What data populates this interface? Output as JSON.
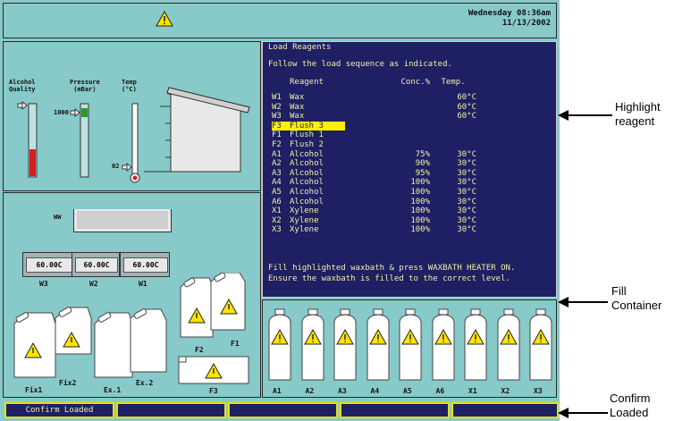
{
  "header": {
    "day_time": "Wednesday 08:36am",
    "date": "11/13/2002"
  },
  "gauges": {
    "alcohol_label": "Alcohol\nQuality",
    "pressure_label": "Pressure\n(mBar)",
    "temp_label": "Temp\n(°C)",
    "pressure_value": "1000",
    "temp_value": "02"
  },
  "waxbaths": {
    "ww_label": "WW",
    "baths": [
      {
        "temp": "60.00C",
        "label": "W3"
      },
      {
        "temp": "60.00C",
        "label": "W2"
      },
      {
        "temp": "60.00C",
        "label": "W1"
      }
    ]
  },
  "containers": {
    "left": [
      "Fix1",
      "Fix2",
      "Ex.1",
      "Ex.2"
    ],
    "flush": [
      "F2",
      "F1",
      "F3"
    ]
  },
  "reagent_panel": {
    "title": "Load Reagents",
    "instruction": "Follow the load sequence as indicated.",
    "headers": {
      "reagent": "Reagent",
      "conc": "Conc.%",
      "temp": "Temp."
    },
    "rows": [
      {
        "id": "W1",
        "name": "Wax",
        "conc": "",
        "temp": "60°C",
        "highlight": false
      },
      {
        "id": "W2",
        "name": "Wax",
        "conc": "",
        "temp": "60°C",
        "highlight": false
      },
      {
        "id": "W3",
        "name": "Wax",
        "conc": "",
        "temp": "60°C",
        "highlight": false
      },
      {
        "id": "F3",
        "name": "Flush 3",
        "conc": "",
        "temp": "",
        "highlight": true
      },
      {
        "id": "F1",
        "name": "Flush 1",
        "conc": "",
        "temp": "",
        "highlight": false
      },
      {
        "id": "F2",
        "name": "Flush 2",
        "conc": "",
        "temp": "",
        "highlight": false
      },
      {
        "id": "A1",
        "name": "Alcohol",
        "conc": "75%",
        "temp": "30°C",
        "highlight": false
      },
      {
        "id": "A2",
        "name": "Alcohol",
        "conc": "90%",
        "temp": "30°C",
        "highlight": false
      },
      {
        "id": "A3",
        "name": "Alcohol",
        "conc": "95%",
        "temp": "30°C",
        "highlight": false
      },
      {
        "id": "A4",
        "name": "Alcohol",
        "conc": "100%",
        "temp": "30°C",
        "highlight": false
      },
      {
        "id": "A5",
        "name": "Alcohol",
        "conc": "100%",
        "temp": "30°C",
        "highlight": false
      },
      {
        "id": "A6",
        "name": "Alcohol",
        "conc": "100%",
        "temp": "30°C",
        "highlight": false
      },
      {
        "id": "X1",
        "name": "Xylene",
        "conc": "100%",
        "temp": "30°C",
        "highlight": false
      },
      {
        "id": "X2",
        "name": "Xylene",
        "conc": "100%",
        "temp": "30°C",
        "highlight": false
      },
      {
        "id": "X3",
        "name": "Xylene",
        "conc": "100%",
        "temp": "30°C",
        "highlight": false
      }
    ],
    "message_line1": "Fill highlighted waxbath & press WAXBATH HEATER ON.",
    "message_line2": "Ensure the waxbath is filled to the correct level."
  },
  "reagent_bottles": [
    "A1",
    "A2",
    "A3",
    "A4",
    "A5",
    "A6",
    "X1",
    "X2",
    "X3"
  ],
  "footer": {
    "confirm_label": "Confirm Loaded",
    "btn2": "",
    "btn3": "",
    "btn4": "",
    "btn5": ""
  },
  "annotations": {
    "highlight": "Highlight\nreagent",
    "fill": "Fill\nContainer",
    "confirm": "Confirm\nLoaded"
  },
  "colors": {
    "screen_bg": "#88c9c9",
    "panel_bg": "#1f1f63",
    "panel_text": "#f0f0a8",
    "highlight": "#ffef00",
    "warning": "#ffe400",
    "alcohol_level": "#d42020",
    "pressure_level": "#2a9a2a"
  }
}
